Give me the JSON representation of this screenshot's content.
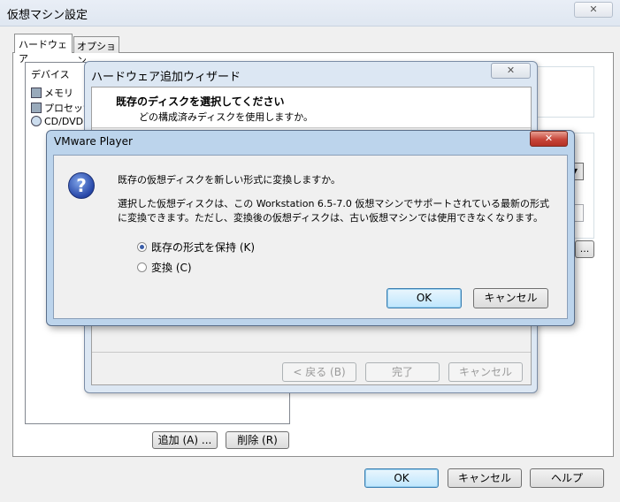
{
  "main": {
    "title": "仮想マシン設定",
    "close_glyph": "✕",
    "tabs": [
      {
        "label": "ハードウェア"
      },
      {
        "label": "オプション"
      }
    ],
    "device_header": "デバイス",
    "devices": [
      {
        "label": "メモリ",
        "icon": "memory-icon"
      },
      {
        "label": "プロセッサ",
        "icon": "processor-icon"
      },
      {
        "label": "CD/DVD (",
        "icon": "cd-dvd-icon"
      }
    ],
    "add_label": "追加 (A) ...",
    "remove_label": "削除 (R)",
    "browse_label": "...",
    "ok_label": "OK",
    "cancel_label": "キャンセル",
    "help_label": "ヘルプ"
  },
  "wizard": {
    "title": "ハードウェア追加ウィザード",
    "close_glyph": "✕",
    "heading": "既存のディスクを選択してください",
    "subheading": "どの構成済みディスクを使用しますか。",
    "back_label": "< 戻る (B)",
    "finish_label": "完了",
    "cancel_label": "キャンセル"
  },
  "dialog": {
    "title": "VMware Player",
    "close_glyph": "✕",
    "icon": "question-icon",
    "icon_glyph": "?",
    "question": "既存の仮想ディスクを新しい形式に変換しますか。",
    "detail": "選択した仮想ディスクは、この Workstation 6.5-7.0 仮想マシンでサポートされている最新の形式に変換できます。ただし、変換後の仮想ディスクは、古い仮想マシンでは使用できなくなります。",
    "options": [
      {
        "label": "既存の形式を保持 (K)",
        "selected": true
      },
      {
        "label": "変換 (C)",
        "selected": false
      }
    ],
    "ok_label": "OK",
    "cancel_label": "キャンセル"
  }
}
